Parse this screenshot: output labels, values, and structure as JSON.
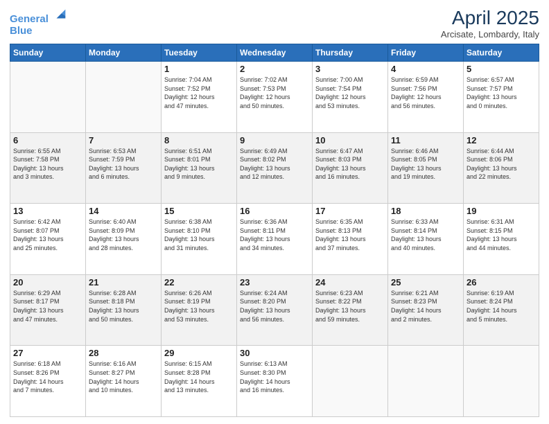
{
  "header": {
    "logo_line1": "General",
    "logo_line2": "Blue",
    "month": "April 2025",
    "location": "Arcisate, Lombardy, Italy"
  },
  "days_of_week": [
    "Sunday",
    "Monday",
    "Tuesday",
    "Wednesday",
    "Thursday",
    "Friday",
    "Saturday"
  ],
  "weeks": [
    [
      {
        "day": "",
        "info": ""
      },
      {
        "day": "",
        "info": ""
      },
      {
        "day": "1",
        "info": "Sunrise: 7:04 AM\nSunset: 7:52 PM\nDaylight: 12 hours\nand 47 minutes."
      },
      {
        "day": "2",
        "info": "Sunrise: 7:02 AM\nSunset: 7:53 PM\nDaylight: 12 hours\nand 50 minutes."
      },
      {
        "day": "3",
        "info": "Sunrise: 7:00 AM\nSunset: 7:54 PM\nDaylight: 12 hours\nand 53 minutes."
      },
      {
        "day": "4",
        "info": "Sunrise: 6:59 AM\nSunset: 7:56 PM\nDaylight: 12 hours\nand 56 minutes."
      },
      {
        "day": "5",
        "info": "Sunrise: 6:57 AM\nSunset: 7:57 PM\nDaylight: 13 hours\nand 0 minutes."
      }
    ],
    [
      {
        "day": "6",
        "info": "Sunrise: 6:55 AM\nSunset: 7:58 PM\nDaylight: 13 hours\nand 3 minutes."
      },
      {
        "day": "7",
        "info": "Sunrise: 6:53 AM\nSunset: 7:59 PM\nDaylight: 13 hours\nand 6 minutes."
      },
      {
        "day": "8",
        "info": "Sunrise: 6:51 AM\nSunset: 8:01 PM\nDaylight: 13 hours\nand 9 minutes."
      },
      {
        "day": "9",
        "info": "Sunrise: 6:49 AM\nSunset: 8:02 PM\nDaylight: 13 hours\nand 12 minutes."
      },
      {
        "day": "10",
        "info": "Sunrise: 6:47 AM\nSunset: 8:03 PM\nDaylight: 13 hours\nand 16 minutes."
      },
      {
        "day": "11",
        "info": "Sunrise: 6:46 AM\nSunset: 8:05 PM\nDaylight: 13 hours\nand 19 minutes."
      },
      {
        "day": "12",
        "info": "Sunrise: 6:44 AM\nSunset: 8:06 PM\nDaylight: 13 hours\nand 22 minutes."
      }
    ],
    [
      {
        "day": "13",
        "info": "Sunrise: 6:42 AM\nSunset: 8:07 PM\nDaylight: 13 hours\nand 25 minutes."
      },
      {
        "day": "14",
        "info": "Sunrise: 6:40 AM\nSunset: 8:09 PM\nDaylight: 13 hours\nand 28 minutes."
      },
      {
        "day": "15",
        "info": "Sunrise: 6:38 AM\nSunset: 8:10 PM\nDaylight: 13 hours\nand 31 minutes."
      },
      {
        "day": "16",
        "info": "Sunrise: 6:36 AM\nSunset: 8:11 PM\nDaylight: 13 hours\nand 34 minutes."
      },
      {
        "day": "17",
        "info": "Sunrise: 6:35 AM\nSunset: 8:13 PM\nDaylight: 13 hours\nand 37 minutes."
      },
      {
        "day": "18",
        "info": "Sunrise: 6:33 AM\nSunset: 8:14 PM\nDaylight: 13 hours\nand 40 minutes."
      },
      {
        "day": "19",
        "info": "Sunrise: 6:31 AM\nSunset: 8:15 PM\nDaylight: 13 hours\nand 44 minutes."
      }
    ],
    [
      {
        "day": "20",
        "info": "Sunrise: 6:29 AM\nSunset: 8:17 PM\nDaylight: 13 hours\nand 47 minutes."
      },
      {
        "day": "21",
        "info": "Sunrise: 6:28 AM\nSunset: 8:18 PM\nDaylight: 13 hours\nand 50 minutes."
      },
      {
        "day": "22",
        "info": "Sunrise: 6:26 AM\nSunset: 8:19 PM\nDaylight: 13 hours\nand 53 minutes."
      },
      {
        "day": "23",
        "info": "Sunrise: 6:24 AM\nSunset: 8:20 PM\nDaylight: 13 hours\nand 56 minutes."
      },
      {
        "day": "24",
        "info": "Sunrise: 6:23 AM\nSunset: 8:22 PM\nDaylight: 13 hours\nand 59 minutes."
      },
      {
        "day": "25",
        "info": "Sunrise: 6:21 AM\nSunset: 8:23 PM\nDaylight: 14 hours\nand 2 minutes."
      },
      {
        "day": "26",
        "info": "Sunrise: 6:19 AM\nSunset: 8:24 PM\nDaylight: 14 hours\nand 5 minutes."
      }
    ],
    [
      {
        "day": "27",
        "info": "Sunrise: 6:18 AM\nSunset: 8:26 PM\nDaylight: 14 hours\nand 7 minutes."
      },
      {
        "day": "28",
        "info": "Sunrise: 6:16 AM\nSunset: 8:27 PM\nDaylight: 14 hours\nand 10 minutes."
      },
      {
        "day": "29",
        "info": "Sunrise: 6:15 AM\nSunset: 8:28 PM\nDaylight: 14 hours\nand 13 minutes."
      },
      {
        "day": "30",
        "info": "Sunrise: 6:13 AM\nSunset: 8:30 PM\nDaylight: 14 hours\nand 16 minutes."
      },
      {
        "day": "",
        "info": ""
      },
      {
        "day": "",
        "info": ""
      },
      {
        "day": "",
        "info": ""
      }
    ]
  ]
}
